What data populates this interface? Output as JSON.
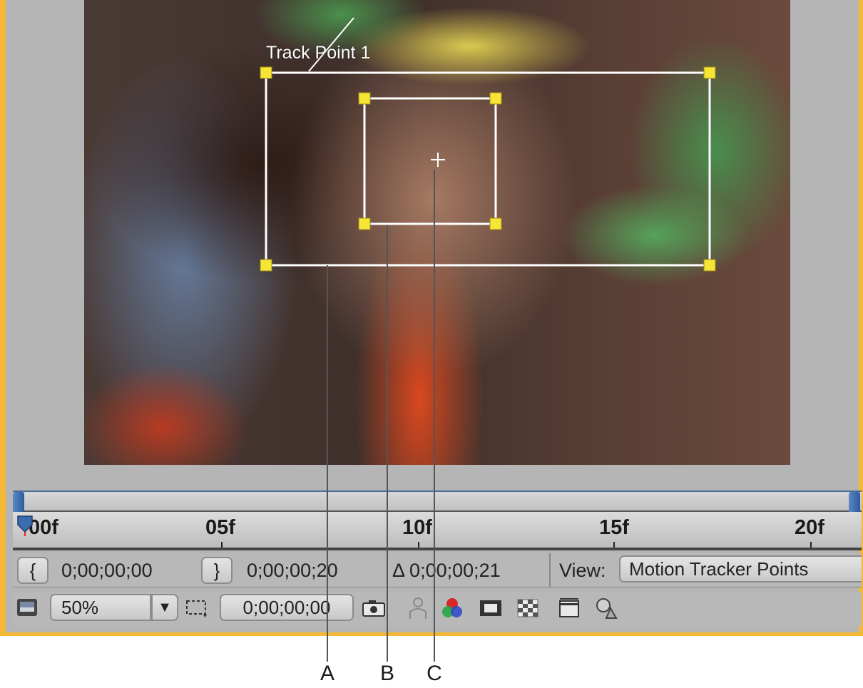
{
  "viewer": {
    "track_label": "Track Point 1"
  },
  "timeline": {
    "ticks": [
      "00f",
      "05f",
      "10f",
      "15f",
      "20f"
    ]
  },
  "controls": {
    "in_point": "0;00;00;00",
    "out_point": "0;00;00;20",
    "duration": "Δ 0;00;00;21",
    "view_label": "View:",
    "view_value": "Motion Tracker Points",
    "zoom": "50%",
    "current_time": "0;00;00;00"
  },
  "callouts": [
    "A",
    "B",
    "C"
  ],
  "icons": {
    "in_point": "set-in-point-icon",
    "out_point": "set-out-point-icon",
    "monitor": "always-preview-icon",
    "dropdown": "chevron-down-icon",
    "region": "region-of-interest-icon",
    "snapshot": "snapshot-camera-icon",
    "person": "show-snapshot-icon",
    "channels": "rgb-channels-icon",
    "grid": "grid-overlay-icon",
    "checker": "transparency-grid-icon",
    "safe": "title-safe-icon",
    "3d": "3d-view-icon"
  },
  "colors": {
    "tracker": "#f7e536",
    "border": "#f3b835",
    "accent": "#3a6db0"
  }
}
